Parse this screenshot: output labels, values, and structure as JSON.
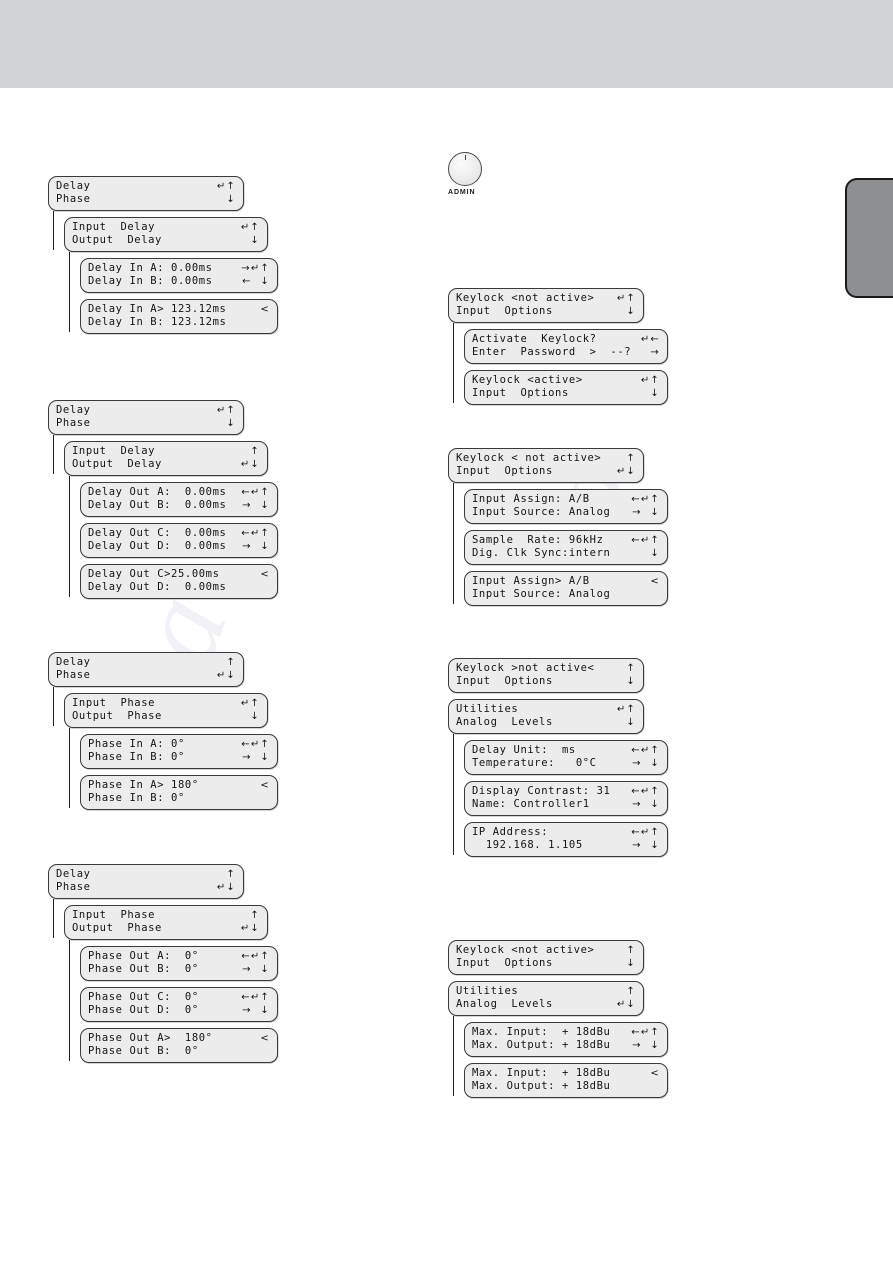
{
  "page": {
    "background_color": "#ffffff",
    "top_band_color": "#d2d3d5",
    "side_tab_color": "#8d8f91",
    "lcd_color": "#ececec"
  },
  "knob": {
    "label": "ADMIN",
    "icon": "rotary-knob"
  },
  "left_column": {
    "groups": [
      {
        "id": "input-delay",
        "screens": [
          {
            "level": 0,
            "line1": "Delay",
            "line2": "Phase",
            "keys1": "↵↑",
            "keys2": "↓"
          },
          {
            "level": 1,
            "line1": "Input  Delay",
            "line2": "Output  Delay",
            "keys1": "↵↑",
            "keys2": "↓"
          },
          {
            "level": 2,
            "line1": "Delay In A: 0.00ms",
            "line2": "Delay In B: 0.00ms",
            "keys1": "→↵↑",
            "keys2": "←  ↓"
          },
          {
            "level": 2,
            "line1": "Delay In A> 123.12ms",
            "line2": "Delay In B: 123.12ms",
            "keys1": "<",
            "keys2": ""
          }
        ]
      },
      {
        "id": "output-delay",
        "screens": [
          {
            "level": 0,
            "line1": "Delay",
            "line2": "Phase",
            "keys1": "↵↑",
            "keys2": "↓"
          },
          {
            "level": 1,
            "line1": "Input  Delay",
            "line2": "Output  Delay",
            "keys1": "↑",
            "keys2": "↵↓"
          },
          {
            "level": 2,
            "line1": "Delay Out A:  0.00ms",
            "line2": "Delay Out B:  0.00ms",
            "keys1": "←↵↑",
            "keys2": "→  ↓"
          },
          {
            "level": 2,
            "line1": "Delay Out C:  0.00ms",
            "line2": "Delay Out D:  0.00ms",
            "keys1": "←↵↑",
            "keys2": "→  ↓"
          },
          {
            "level": 2,
            "line1": "Delay Out C>25.00ms",
            "line2": "Delay Out D:  0.00ms",
            "keys1": "<",
            "keys2": ""
          }
        ]
      },
      {
        "id": "input-phase",
        "screens": [
          {
            "level": 0,
            "line1": "Delay",
            "line2": "Phase",
            "keys1": "↑",
            "keys2": "↵↓"
          },
          {
            "level": 1,
            "line1": "Input  Phase",
            "line2": "Output  Phase",
            "keys1": "↵↑",
            "keys2": "↓"
          },
          {
            "level": 2,
            "line1": "Phase In A: 0°",
            "line2": "Phase In B: 0°",
            "keys1": "←↵↑",
            "keys2": "→  ↓"
          },
          {
            "level": 2,
            "line1": "Phase In A> 180°",
            "line2": "Phase In B: 0°",
            "keys1": "<",
            "keys2": ""
          }
        ]
      },
      {
        "id": "output-phase",
        "screens": [
          {
            "level": 0,
            "line1": "Delay",
            "line2": "Phase",
            "keys1": "↑",
            "keys2": "↵↓"
          },
          {
            "level": 1,
            "line1": "Input  Phase",
            "line2": "Output  Phase",
            "keys1": "↑",
            "keys2": "↵↓"
          },
          {
            "level": 2,
            "line1": "Phase Out A:  0°",
            "line2": "Phase Out B:  0°",
            "keys1": "←↵↑",
            "keys2": "→  ↓"
          },
          {
            "level": 2,
            "line1": "Phase Out C:  0°",
            "line2": "Phase Out D:  0°",
            "keys1": "←↵↑",
            "keys2": "→  ↓"
          },
          {
            "level": 2,
            "line1": "Phase Out A>  180°",
            "line2": "Phase Out B:  0°",
            "keys1": "<",
            "keys2": ""
          }
        ]
      }
    ]
  },
  "right_column": {
    "groups": [
      {
        "id": "keylock",
        "screens": [
          {
            "level": 0,
            "line1": "Keylock <not active>",
            "line2": "Input  Options",
            "keys1": "↵↑",
            "keys2": "↓"
          },
          {
            "level": 1,
            "line1": "Activate  Keylock?",
            "line2": "Enter  Password  >  --?",
            "keys1": "↵←",
            "keys2": "→"
          },
          {
            "level": 1,
            "line1": "Keylock <active>",
            "line2": "Input  Options",
            "keys1": "↵↑",
            "keys2": "↓"
          }
        ]
      },
      {
        "id": "input-options",
        "screens": [
          {
            "level": 0,
            "line1": "Keylock < not active>",
            "line2": "Input  Options",
            "keys1": "↑",
            "keys2": "↵↓"
          },
          {
            "level": 1,
            "line1": "Input Assign: A/B",
            "line2": "Input Source: Analog",
            "keys1": "←↵↑",
            "keys2": "→  ↓"
          },
          {
            "level": 1,
            "line1": "Sample  Rate: 96kHz",
            "line2": "Dig. Clk Sync:intern",
            "keys1": "←↵↑",
            "keys2": "↓"
          },
          {
            "level": 1,
            "line1": "Input Assign> A/B",
            "line2": "Input Source: Analog",
            "keys1": "<",
            "keys2": ""
          }
        ]
      },
      {
        "id": "utilities",
        "screens": [
          {
            "level": 0,
            "line1": "Keylock >not active<",
            "line2": "Input  Options",
            "keys1": "↑",
            "keys2": "↓"
          },
          {
            "level": 0,
            "line1": "Utilities",
            "line2": "Analog  Levels",
            "keys1": "↵↑",
            "keys2": "↓"
          },
          {
            "level": 1,
            "line1": "Delay Unit:  ms",
            "line2": "Temperature:   0°C",
            "keys1": "←↵↑",
            "keys2": "→  ↓"
          },
          {
            "level": 1,
            "line1": "Display Contrast: 31",
            "line2": "Name: Controller1",
            "keys1": "←↵↑",
            "keys2": "→  ↓"
          },
          {
            "level": 1,
            "line1": "IP Address:",
            "line2": "  192.168. 1.105",
            "keys1": "←↵↑",
            "keys2": "→  ↓"
          }
        ]
      },
      {
        "id": "analog-levels",
        "screens": [
          {
            "level": 0,
            "line1": "Keylock <not active>",
            "line2": "Input  Options",
            "keys1": "↑",
            "keys2": "↓"
          },
          {
            "level": 0,
            "line1": "Utilities",
            "line2": "Analog  Levels",
            "keys1": "↑",
            "keys2": "↵↓"
          },
          {
            "level": 1,
            "line1": "Max. Input:  + 18dBu",
            "line2": "Max. Output: + 18dBu",
            "keys1": "←↵↑",
            "keys2": "→  ↓"
          },
          {
            "level": 1,
            "line1": "Max. Input:  + 18dBu",
            "line2": "Max. Output: + 18dBu",
            "keys1": "<",
            "keys2": ""
          }
        ]
      }
    ]
  }
}
